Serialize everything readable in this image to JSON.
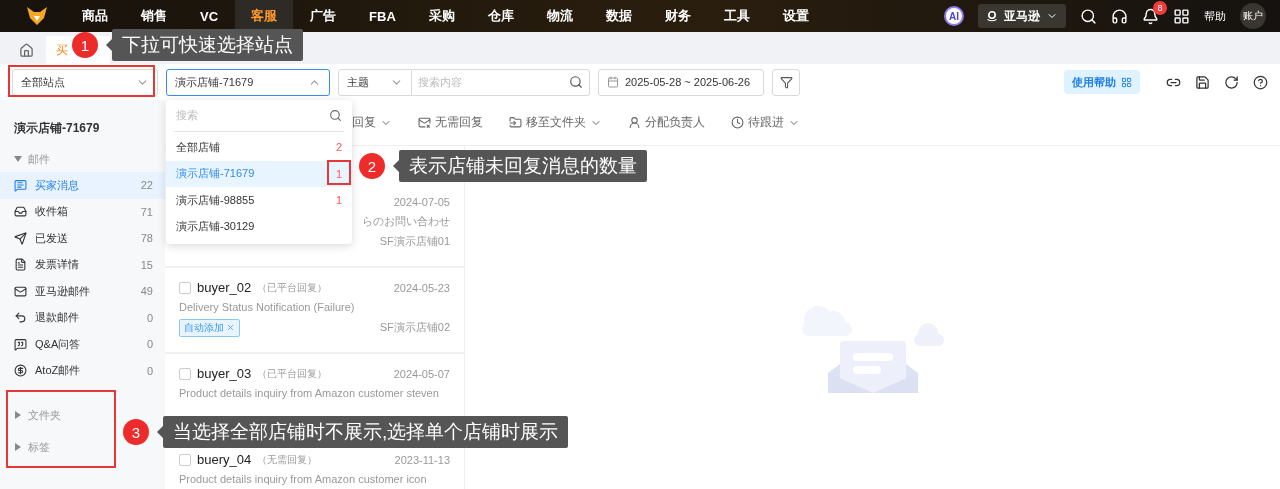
{
  "nav": {
    "items": [
      {
        "label": "商品",
        "selected": false
      },
      {
        "label": "销售",
        "selected": false
      },
      {
        "label": "VC",
        "selected": false
      },
      {
        "label": "客服",
        "selected": true
      },
      {
        "label": "广告",
        "selected": false
      },
      {
        "label": "FBA",
        "selected": false
      },
      {
        "label": "采购",
        "selected": false
      },
      {
        "label": "仓库",
        "selected": false
      },
      {
        "label": "物流",
        "selected": false
      },
      {
        "label": "数据",
        "selected": false
      },
      {
        "label": "财务",
        "selected": false
      },
      {
        "label": "工具",
        "selected": false
      },
      {
        "label": "设置",
        "selected": false
      }
    ],
    "ai": "AI",
    "platform": "亚马逊",
    "notification_count": "8",
    "help": "帮助",
    "account": "账户"
  },
  "tabs": [
    {
      "label": "买",
      "selected": true
    }
  ],
  "filters": {
    "site": "全部站点",
    "store": "演示店铺-71679",
    "field": "主题",
    "search_placeholder": "搜索内容",
    "date_range": "2025-05-28 ~ 2025-06-26",
    "help_button": "使用帮助"
  },
  "store_dropdown": {
    "search_placeholder": "搜索",
    "options": [
      {
        "label": "全部店铺",
        "count": "2",
        "selected": false
      },
      {
        "label": "演示店铺-71679",
        "count": "1",
        "selected": true
      },
      {
        "label": "演示店铺-98855",
        "count": "1",
        "selected": false
      },
      {
        "label": "演示店铺-30129",
        "selected": false
      }
    ]
  },
  "sidebar": {
    "title": "演示店铺-71679",
    "sections": [
      {
        "label": "邮件",
        "expanded": true,
        "items": [
          {
            "label": "买家消息",
            "count": "22",
            "selected": true
          },
          {
            "label": "收件箱",
            "count": "71",
            "selected": false
          },
          {
            "label": "已发送",
            "count": "78",
            "selected": false
          },
          {
            "label": "发票详情",
            "count": "15",
            "selected": false
          },
          {
            "label": "亚马逊邮件",
            "count": "49",
            "selected": false
          },
          {
            "label": "退款邮件",
            "count": "0",
            "selected": false
          },
          {
            "label": "Q&A问答",
            "count": "0",
            "selected": false
          },
          {
            "label": "AtoZ邮件",
            "count": "0",
            "selected": false
          }
        ]
      },
      {
        "label": "文件夹",
        "expanded": false
      },
      {
        "label": "标签",
        "expanded": false
      }
    ]
  },
  "toolbar": [
    {
      "label": "回复",
      "menu": true
    },
    {
      "label": "无需回复",
      "menu": false
    },
    {
      "label": "移至文件夹",
      "menu": true
    },
    {
      "label": "分配负责人",
      "menu": false
    },
    {
      "label": "待跟进",
      "menu": true
    }
  ],
  "messages": [
    {
      "kind": "covered",
      "date": "2024-07-05",
      "subject": "らのお問い合わせ",
      "shop": "SF演示店铺01"
    },
    {
      "kind": "full",
      "checked": false,
      "buyer": "buyer_02",
      "status": "（已平台回复）",
      "date": "2024-05-23",
      "subject": "Delivery Status Notification (Failure)",
      "tag": "自动添加",
      "shop": "SF演示店铺02"
    },
    {
      "kind": "full",
      "checked": false,
      "buyer": "buyer_03",
      "status": "（已平台回复）",
      "date": "2024-05-07",
      "subject": "Product details inquiry from Amazon customer steven"
    },
    {
      "kind": "full",
      "checked": false,
      "buyer": "buery_04",
      "status": "（无需回复）",
      "date": "2023-11-13",
      "subject": "Product details inquiry from Amazon customer icon"
    }
  ],
  "callouts": [
    {
      "number": "1",
      "text": "下拉可快速选择站点"
    },
    {
      "number": "2",
      "text": "表示店铺未回复消息的数量"
    },
    {
      "number": "3",
      "text": "当选择全部店铺时不展示,选择单个店铺时展示"
    }
  ]
}
